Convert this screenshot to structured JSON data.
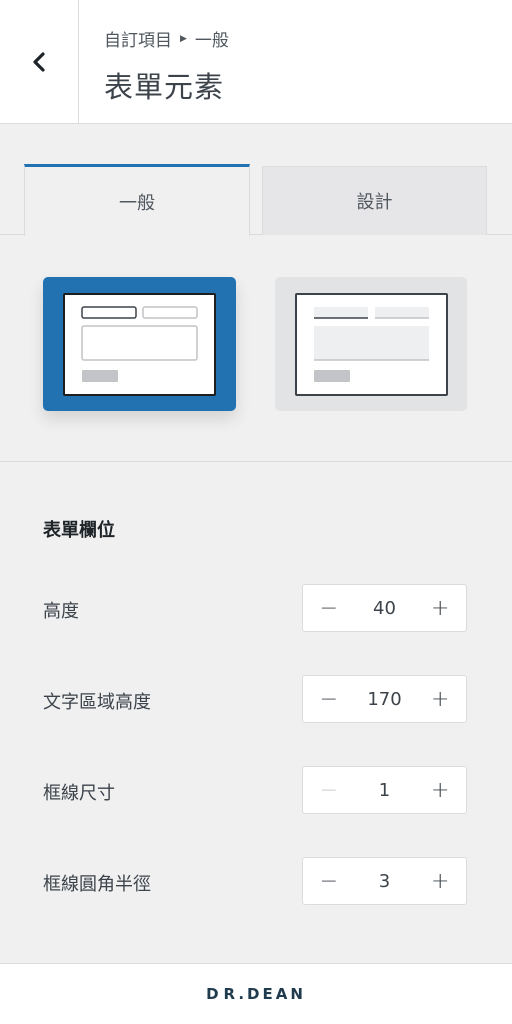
{
  "header": {
    "breadcrumb": {
      "root": "自訂項目",
      "current": "一般"
    },
    "title": "表單元素"
  },
  "tabs": [
    {
      "label": "一般",
      "active": true
    },
    {
      "label": "設計",
      "active": false
    }
  ],
  "layout_options": {
    "selected": "option-1",
    "accent_color": "#2271b1"
  },
  "section": {
    "title": "表單欄位",
    "fields": [
      {
        "label": "高度",
        "value": "40",
        "minus_disabled": false
      },
      {
        "label": "文字區域高度",
        "value": "170",
        "minus_disabled": false
      },
      {
        "label": "框線尺寸",
        "value": "1",
        "minus_disabled": true
      },
      {
        "label": "框線圓角半徑",
        "value": "3",
        "minus_disabled": false
      }
    ],
    "minus_symbol": "−",
    "plus_symbol": "+"
  },
  "footer": {
    "logo_text": "R.DEAN",
    "logo_initial": "D"
  }
}
